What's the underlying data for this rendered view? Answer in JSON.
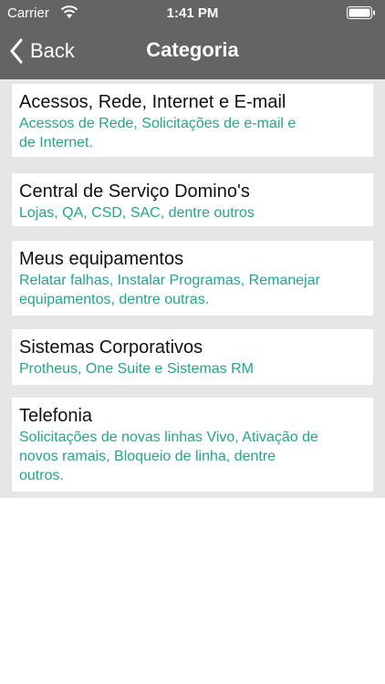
{
  "status_bar": {
    "carrier": "Carrier",
    "time": "1:41 PM",
    "icons": [
      "wifi-icon",
      "battery-icon"
    ]
  },
  "nav": {
    "back_label": "Back",
    "title": "Categoria"
  },
  "colors": {
    "header_bg": "#646464",
    "list_bg": "#e6e6e6",
    "subtitle": "#22a68a"
  },
  "categories": [
    {
      "title": "Acessos, Rede, Internet e E-mail",
      "lines": [
        "Acessos de Rede, Solicitações de e-mail e",
        "de Internet."
      ]
    },
    {
      "title": "Central de Serviço Domino's",
      "lines": [
        "Lojas, QA, CSD, SAC, dentre outros"
      ]
    },
    {
      "title": "Meus equipamentos",
      "lines": [
        "Relatar falhas, Instalar Programas, Remanejar",
        "equipamentos, dentre outras."
      ]
    },
    {
      "title": "Sistemas Corporativos",
      "lines": [
        "Protheus, One Suite e Sistemas RM"
      ]
    },
    {
      "title": "Telefonia",
      "lines": [
        "Solicitações de novas linhas Vivo, Ativação de",
        "novos ramais, Bloqueio de linha, dentre",
        "outros."
      ]
    }
  ]
}
